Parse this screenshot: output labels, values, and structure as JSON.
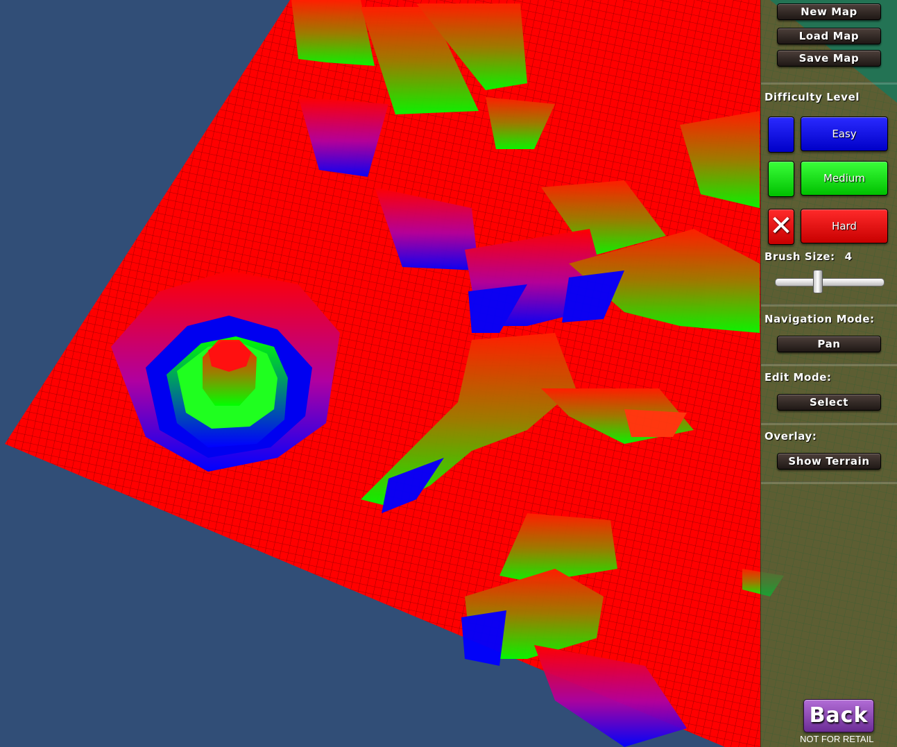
{
  "toolbar": {
    "new_map": "New Map",
    "load_map": "Load Map",
    "save_map": "Save Map"
  },
  "difficulty": {
    "title": "Difficulty Level",
    "levels": [
      {
        "label": "Easy",
        "color": "#0000ff",
        "selected": false
      },
      {
        "label": "Medium",
        "color": "#00ff00",
        "selected": false
      },
      {
        "label": "Hard",
        "color": "#ff0000",
        "selected": true
      }
    ]
  },
  "brush": {
    "label": "Brush Size:",
    "value": "4"
  },
  "navigation": {
    "title": "Navigation Mode:",
    "value": "Pan"
  },
  "edit": {
    "title": "Edit Mode:",
    "value": "Select"
  },
  "overlay": {
    "title": "Overlay:",
    "value": "Show Terrain"
  },
  "back_label": "Back",
  "watermark": "NOT FOR RETAIL",
  "colors": {
    "background": "#314e77",
    "terrain_hard": "#ff0000",
    "terrain_medium": "#00ff00",
    "terrain_easy": "#0000ff",
    "panel": "#1e8246",
    "back_button": "#8b44b8"
  }
}
